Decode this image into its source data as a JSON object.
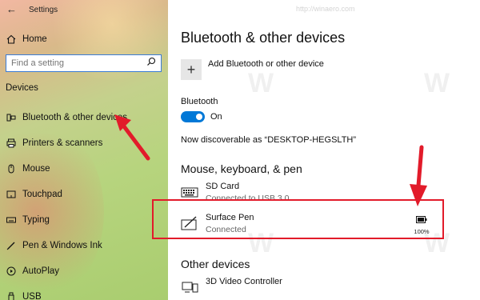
{
  "window": {
    "title": "Settings"
  },
  "sidebar": {
    "home_label": "Home",
    "search_placeholder": "Find a setting",
    "section": "Devices",
    "items": [
      {
        "label": "Bluetooth & other devices",
        "icon": "bluetooth-devices-icon"
      },
      {
        "label": "Printers & scanners",
        "icon": "printer-icon"
      },
      {
        "label": "Mouse",
        "icon": "mouse-icon"
      },
      {
        "label": "Touchpad",
        "icon": "touchpad-icon"
      },
      {
        "label": "Typing",
        "icon": "keyboard-icon"
      },
      {
        "label": "Pen & Windows Ink",
        "icon": "pen-icon"
      },
      {
        "label": "AutoPlay",
        "icon": "autoplay-icon"
      },
      {
        "label": "USB",
        "icon": "usb-icon"
      }
    ]
  },
  "main": {
    "title": "Bluetooth & other devices",
    "add_device_label": "Add Bluetooth or other device",
    "bluetooth_label": "Bluetooth",
    "bluetooth_state": "On",
    "discoverable_text": "Now discoverable as “DESKTOP-HEGSLTH”",
    "mouse_section_heading": "Mouse, keyboard, & pen",
    "devices": [
      {
        "name": "SD Card",
        "status": "Connected to USB 3.0",
        "icon": "keyboard-icon"
      },
      {
        "name": "Surface Pen",
        "status": "Connected",
        "icon": "pen-device-icon",
        "battery": "100%"
      }
    ],
    "other_section_heading": "Other devices",
    "other_devices": [
      {
        "name": "3D Video Controller",
        "icon": "display-device-icon"
      }
    ]
  },
  "watermark": "http://winaero.com",
  "colors": {
    "accent": "#0078d7",
    "annotation": "#e21b2a"
  }
}
